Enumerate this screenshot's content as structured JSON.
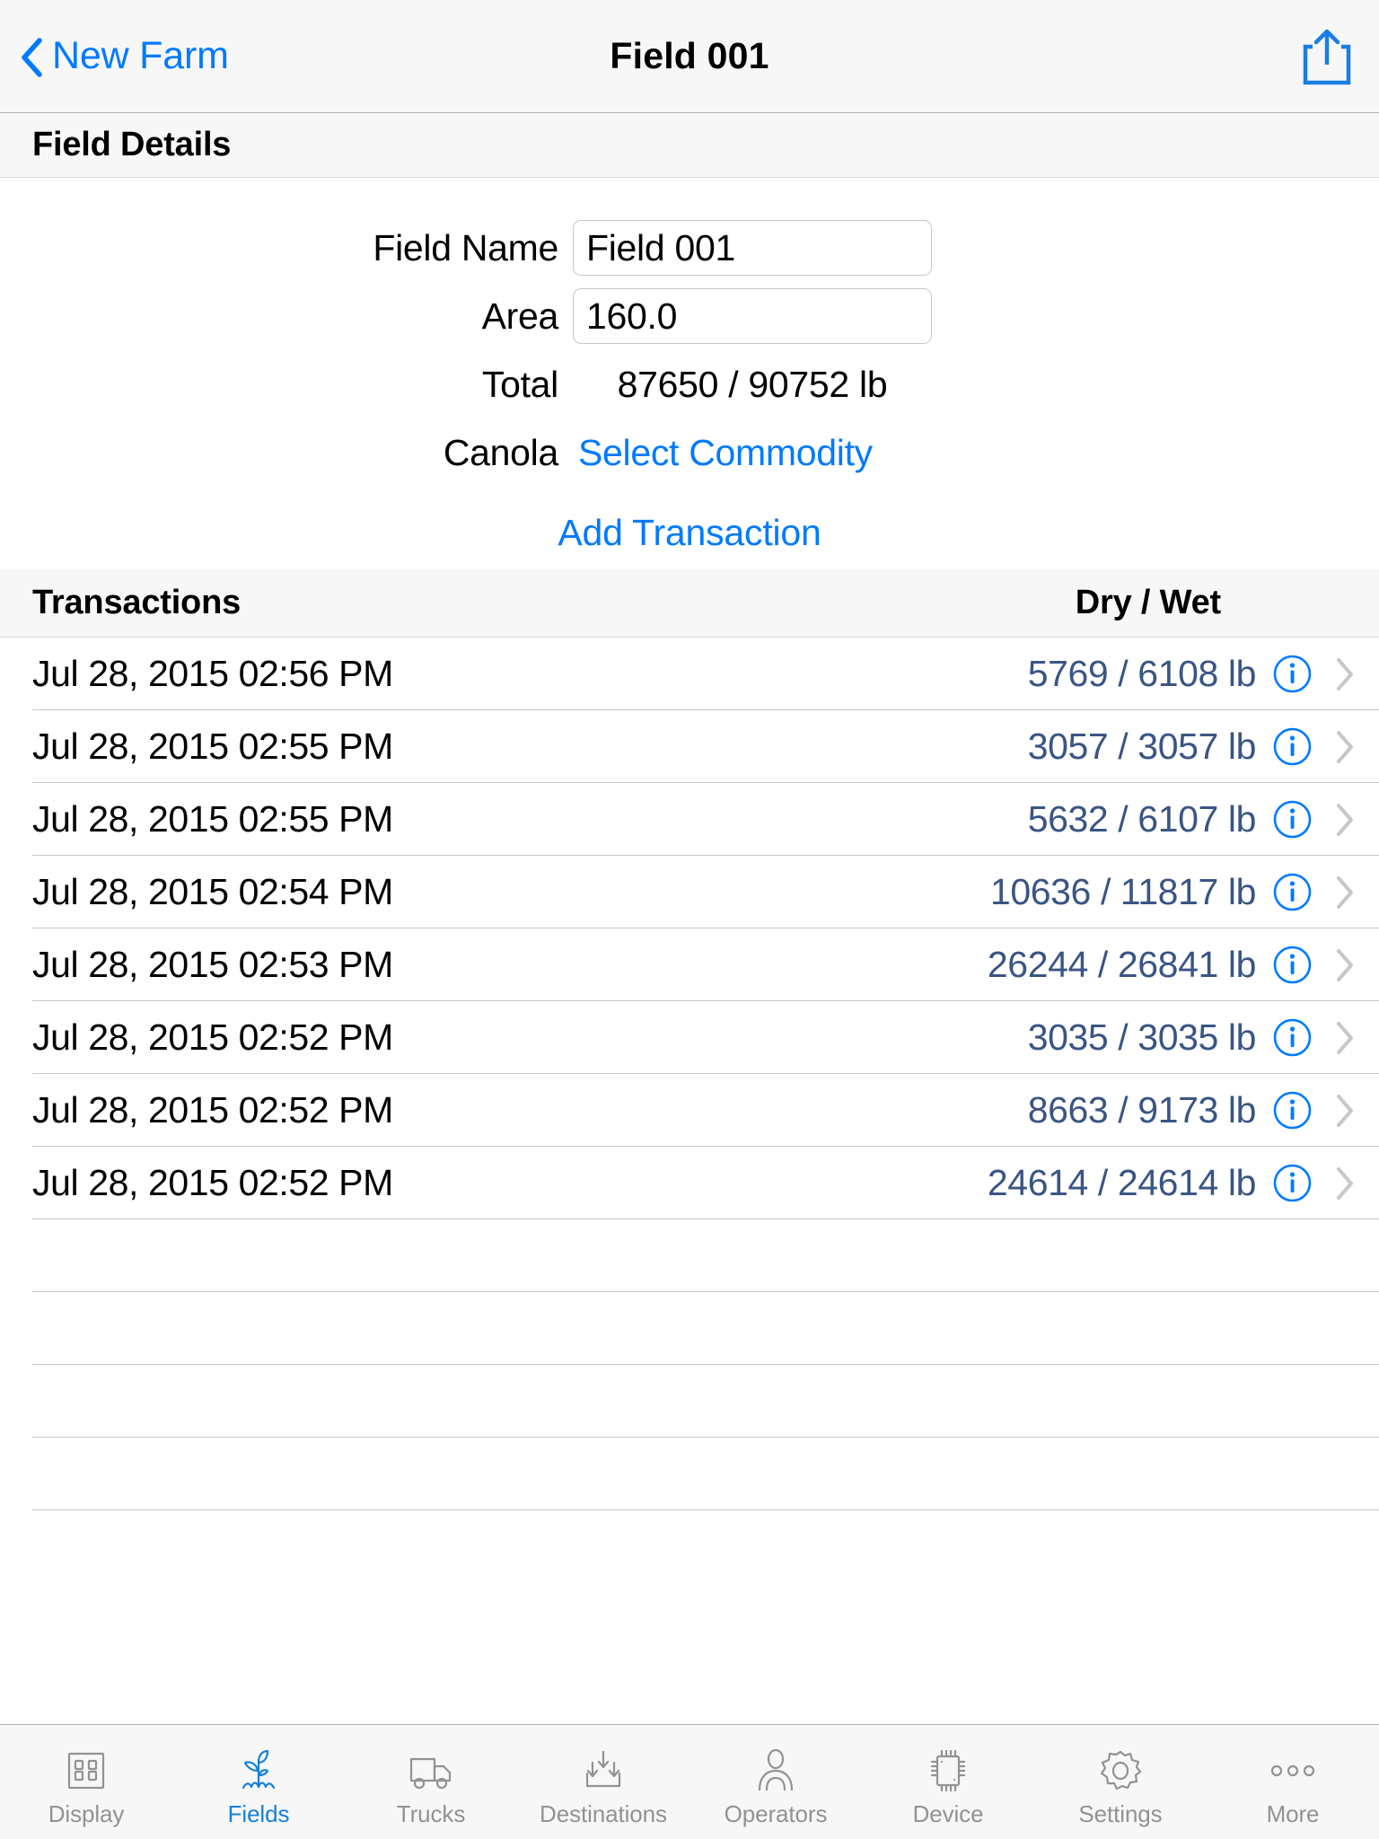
{
  "navbar": {
    "back_label": "New Farm",
    "title": "Field 001",
    "back_icon": "chevron-left-icon",
    "share_icon": "share-icon"
  },
  "details_section": {
    "header": "Field Details",
    "field_name_label": "Field Name",
    "field_name_value": "Field 001",
    "field_name_placeholder": "Field Name",
    "area_label": "Area",
    "area_value": "160.0",
    "area_placeholder": "Area",
    "total_label": "Total",
    "total_value": "87650 / 90752 lb",
    "commodity_label": "Canola",
    "commodity_link": "Select Commodity",
    "add_transaction": "Add Transaction"
  },
  "transactions_section": {
    "header_left": "Transactions",
    "header_right": "Dry / Wet",
    "rows": [
      {
        "date": "Jul 28, 2015 02:56 PM",
        "value": "5769 / 6108 lb"
      },
      {
        "date": "Jul 28, 2015 02:55 PM",
        "value": "3057 / 3057 lb"
      },
      {
        "date": "Jul 28, 2015 02:55 PM",
        "value": "5632 / 6107 lb"
      },
      {
        "date": "Jul 28, 2015 02:54 PM",
        "value": "10636 / 11817 lb"
      },
      {
        "date": "Jul 28, 2015 02:53 PM",
        "value": "26244 / 26841 lb"
      },
      {
        "date": "Jul 28, 2015 02:52 PM",
        "value": "3035 / 3035 lb"
      },
      {
        "date": "Jul 28, 2015 02:52 PM",
        "value": "8663 / 9173 lb"
      },
      {
        "date": "Jul 28, 2015 02:52 PM",
        "value": "24614 / 24614 lb"
      }
    ],
    "empty_row_count": 4,
    "row_info_icon": "info-circle-icon",
    "row_disclosure_icon": "chevron-right-icon"
  },
  "tabbar": {
    "items": [
      {
        "label": "Display",
        "icon": "seven-segment-display-icon",
        "active": false
      },
      {
        "label": "Fields",
        "icon": "plant-sprout-icon",
        "active": true
      },
      {
        "label": "Trucks",
        "icon": "truck-icon",
        "active": false
      },
      {
        "label": "Destinations",
        "icon": "arrows-into-bin-icon",
        "active": false
      },
      {
        "label": "Operators",
        "icon": "person-icon",
        "active": false
      },
      {
        "label": "Device",
        "icon": "chip-icon",
        "active": false
      },
      {
        "label": "Settings",
        "icon": "gear-icon",
        "active": false
      },
      {
        "label": "More",
        "icon": "ellipsis-icon",
        "active": false
      }
    ]
  },
  "colors": {
    "accent_blue": "#007aff",
    "tab_active_blue": "#1580dc",
    "value_navy": "#3a5584",
    "bar_background": "#f7f7f7",
    "separator": "#c8c7cc",
    "inactive_gray": "#929292"
  }
}
